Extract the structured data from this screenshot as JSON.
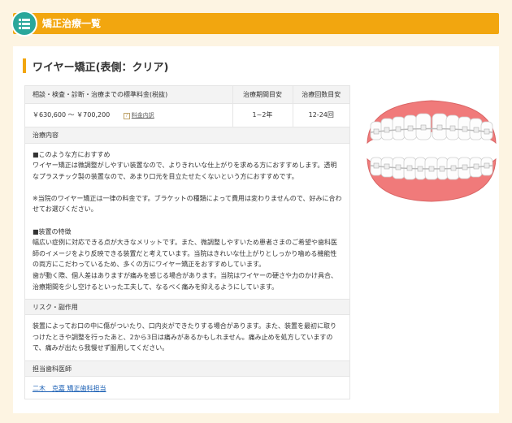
{
  "header": {
    "title": "矯正治療一覧",
    "icon": "list-icon",
    "accent_color": "#f2a60f",
    "icon_color": "#2aa79b"
  },
  "section": {
    "title": "ワイヤー矯正(表側：クリア)"
  },
  "price_table": {
    "headers": [
      "相談・検査・診断・治療までの標準料金(税抜)",
      "治療期間目安",
      "治療回数目安"
    ],
    "price": "￥630,600 〜 ￥700,200",
    "price_detail_link": "料金内訳",
    "period": "1~2年",
    "count": "12-24回"
  },
  "treatment": {
    "heading": "治療内容",
    "paragraphs": [
      "■このような方におすすめ",
      "ワイヤー矯正は微調整がしやすい装置なので、よりきれいな仕上がりを求める方におすすめします。透明なプラスチック製の装置なので、あまり口元を目立たせたくないという方におすすめです。",
      "",
      "※当院のワイヤー矯正は一律の料金です。ブラケットの種類によって費用は変わりませんので、好みに合わせてお選びください。",
      "",
      "■装置の特徴",
      "幅広い症例に対応できる点が大きなメリットです。また、微調整しやすいため患者さまのご希望や歯科医師のイメージをより反映できる装置だと考えています。当院はきれいな仕上がりとしっかり噛める機能性の両方にこだわっているため、多くの方にワイヤー矯正をおすすめしています。",
      "歯が動く際、個人差はありますが痛みを感じる場合があります。当院はワイヤーの硬さや力のかけ具合、治療期間を少し空けるといった工夫して、なるべく痛みを抑えるようにしています。"
    ]
  },
  "risk": {
    "heading": "リスク・副作用",
    "text": "装置によってお口の中に傷がついたり、口内炎ができたりする場合があります。また、装置を最初に取りつけたときや調整を行ったあと、2から3日は痛みがあるかもしれません。痛み止めを処方していますので、痛みが出たら我慢せず服用してください。"
  },
  "doctor": {
    "heading": "担当歯科医師",
    "link": "二木　克嘉 矯正歯科担当"
  },
  "illustration": {
    "icon": "teeth-with-clear-braces-illustration",
    "gum_color": "#f07a7a"
  }
}
